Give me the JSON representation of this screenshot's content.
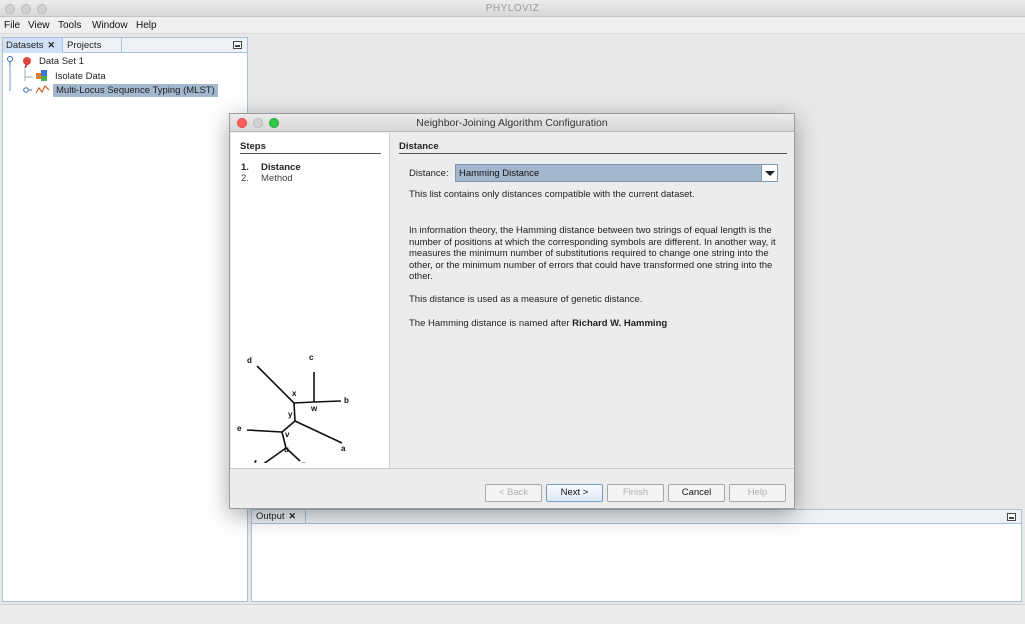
{
  "app": {
    "title": "PHYLOVIZ"
  },
  "menu": [
    "File",
    "View",
    "Tools",
    "Window",
    "Help"
  ],
  "explorer": {
    "tabs": [
      {
        "label": "Datasets"
      },
      {
        "label": "Projects"
      }
    ],
    "tree": [
      {
        "label": "Data Set 1",
        "level": 0
      },
      {
        "label": "Isolate Data",
        "level": 1
      },
      {
        "label": "Multi-Locus Sequence Typing (MLST)",
        "level": 1,
        "selected": true
      }
    ]
  },
  "output": {
    "tab": "Output"
  },
  "dialog": {
    "title": "Neighbor-Joining Algorithm Configuration",
    "steps_header": "Steps",
    "steps": [
      {
        "num": "1.",
        "label": "Distance",
        "active": true
      },
      {
        "num": "2.",
        "label": "Method",
        "active": false
      }
    ],
    "tree_labels": [
      "d",
      "c",
      "x",
      "w",
      "b",
      "y",
      "e",
      "v",
      "a",
      "u",
      "f",
      "g"
    ],
    "content_header": "Distance",
    "distance_label": "Distance:",
    "distance_value": "Hamming Distance",
    "info": "This list contains only distances compatible with the current dataset.",
    "description": "In information theory, the Hamming distance between two strings of equal length is the number of positions at which the corresponding symbols are different. In another way, it measures the minimum number of substitutions required to change one string into the other, or the minimum number of errors that could have transformed one string into the other.",
    "usage": "This distance is used as a measure of genetic distance.",
    "named_prefix": "The Hamming distance is named after ",
    "named_person": "Richard W. Hamming",
    "buttons": {
      "back": "< Back",
      "next": "Next >",
      "finish": "Finish",
      "cancel": "Cancel",
      "help": "Help"
    }
  },
  "colors": {
    "selection": "#a3b8cf",
    "close_red": "#fc605c",
    "min_yellow": "#fdbc40",
    "max_green": "#34c84a"
  }
}
